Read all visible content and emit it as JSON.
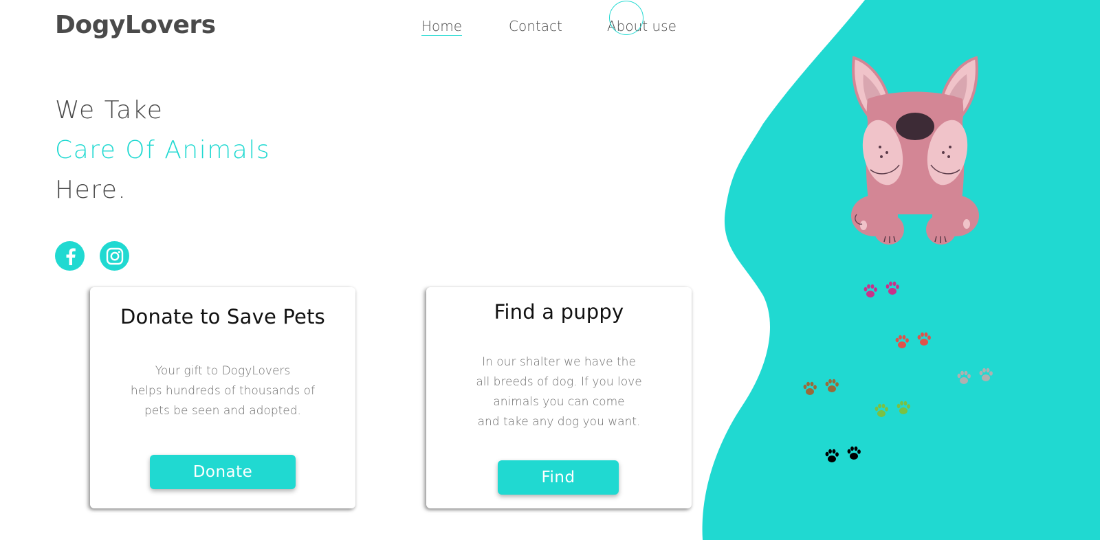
{
  "brand": {
    "logo": "DogyLovers"
  },
  "nav": {
    "items": [
      "Home",
      "Contact",
      "About use"
    ],
    "active": "Home"
  },
  "hero": {
    "line1": "We Take",
    "line2": "Care Of Animals",
    "line3": "Here."
  },
  "social": {
    "icons": [
      "facebook-icon",
      "instagram-icon"
    ]
  },
  "cards": [
    {
      "title": "Donate to Save Pets",
      "lines": [
        "Your gift to DogyLovers",
        "helps hundreds of thousands of",
        "pets be seen and adopted."
      ],
      "button": "Donate"
    },
    {
      "title": "Find a puppy",
      "lines": [
        "In our shalter we have the",
        "all breeds of dog. If you love",
        "animals you can come",
        "and take any dog you want."
      ],
      "button": "Find"
    }
  ],
  "colors": {
    "accent": "#20d9d1",
    "text": "#4a4a4a",
    "dog": "#d38695"
  },
  "paw_colors": [
    "#c8328a",
    "#e0524a",
    "#b0b0b0",
    "#9a6a3a",
    "#7ac143",
    "#000000"
  ]
}
